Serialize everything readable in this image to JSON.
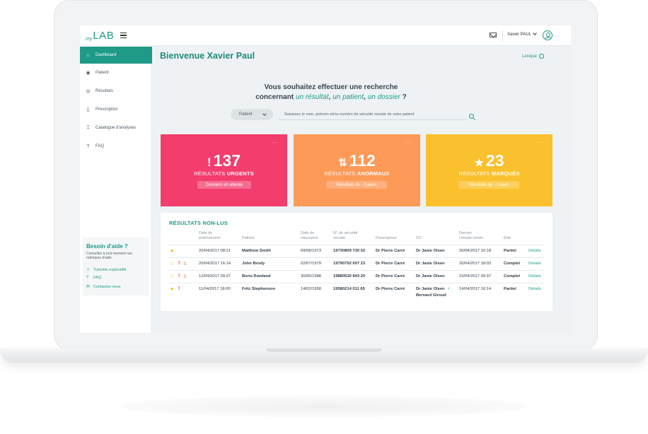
{
  "topbar": {
    "logo_my": "my",
    "logo_lab": "LAB",
    "user_name": "Xavier PAUL"
  },
  "sidebar": {
    "items": [
      {
        "label": "Dashboard",
        "icon": "dashboard-icon"
      },
      {
        "label": "Patient",
        "icon": "patient-icon"
      },
      {
        "label": "Résultats",
        "icon": "eye-icon"
      },
      {
        "label": "Prescription",
        "icon": "prescription-icon"
      },
      {
        "label": "Catalogue d'analyses",
        "icon": "test-tube-icon"
      },
      {
        "label": "FAQ",
        "icon": "question-icon"
      }
    ],
    "help": {
      "title": "Besoin d'aide ?",
      "subtitle": "Consultez à tout moment nos rubriques d'aide.",
      "links": [
        {
          "label": "Tutoriels explicatifs",
          "icon": "magic-wand-icon"
        },
        {
          "label": "FAQ",
          "icon": "question-icon"
        },
        {
          "label": "Contactez-nous",
          "icon": "contact-icon"
        }
      ]
    }
  },
  "main": {
    "welcome": "Bienvenue Xavier Paul",
    "lexique": "Lexique",
    "question_line1": "Vous souhaitez effectuer une recherche",
    "question_line2_prefix": "concernant ",
    "question_em1": "un résultat",
    "question_sep1": ", ",
    "question_em2": "un patient",
    "question_sep2": ", ",
    "question_em3": "un dossier",
    "question_suffix": " ?",
    "search_type": "Patient",
    "search_placeholder": "Saisissez le nom, prénom et/ou numéro de sécurité sociale de votre patient"
  },
  "cards": [
    {
      "icon": "!",
      "count": "137",
      "label_prefix": "RÉSULTATS ",
      "label_bold": "URGENTS",
      "pill": "Dossiers en attente",
      "color": "#f23d6d",
      "pill_bg": "#f56d90"
    },
    {
      "icon": "⇅",
      "count": "112",
      "label_prefix": "RÉSULTATS ",
      "label_bold": "ANORMAUX",
      "pill": "Résultats de - 3 jours",
      "color": "#fd9a58",
      "pill_bg": "#fdb07d"
    },
    {
      "icon": "★",
      "count": "23",
      "label_prefix": "RÉSULTATS ",
      "label_bold": "MARQUÉS",
      "pill": "Résultats de - 3 jours",
      "color": "#fbc02d",
      "pill_bg": "#fcce5a"
    }
  ],
  "table": {
    "title": "RÉSULTATS NON-LUS",
    "headers": {
      "date_prelev": [
        "Date de",
        "prélèvement"
      ],
      "patient": "Patient",
      "naissance": [
        "Date de",
        "naissance"
      ],
      "secu": [
        "N° de sécurité",
        "sociale"
      ],
      "prescripteur": "Prescripteur",
      "cc": "CC",
      "dernier": [
        "Dernier",
        "compte-rendu"
      ],
      "etat": "Etat"
    },
    "rows": [
      {
        "date": "20/04/2017 08:21",
        "patient": "Matthew Smith",
        "naissance": "09/08/1973",
        "secu": "19730809 730 02",
        "prescripteur": "Dr Pierre Carré",
        "cc": "Dr Janie Olsen",
        "cc2": "",
        "dernier": "20/04/2017 16:18",
        "etat": "Partiel",
        "action": "Détails",
        "star": "filled",
        "urgent": false,
        "abnormal": false
      },
      {
        "date": "20/04/2017 16:14",
        "patient": "John Brody",
        "naissance": "02/07/1979",
        "secu": "19790702 007 23",
        "prescripteur": "Dr Pierre Carré",
        "cc": "Dr Janie Olsen",
        "cc2": "",
        "dernier": "20/04/2017 18:03",
        "etat": "Complet",
        "action": "Détails",
        "star": "outline",
        "urgent": true,
        "abnormal": true
      },
      {
        "date": "12/04/2017 09:37",
        "patient": "Boris Rowland",
        "naissance": "30/05/1988",
        "secu": "19880530 843 20",
        "prescripteur": "Dr Pierre Carré",
        "cc": "Dr Janie Olsen",
        "cc2": "",
        "dernier": "16/04/2017 09:37",
        "etat": "Complet",
        "action": "Détails",
        "star": "outline",
        "urgent": true,
        "abnormal": true
      },
      {
        "date": "11/04/2017 18:00",
        "patient": "Fritz Stephenson",
        "naissance": "14/02/1958",
        "secu": "19580214 011 65",
        "prescripteur": "Dr Pierre Carré",
        "cc": "Dr Janie Olsen",
        "cc2": "Bernard Giroud",
        "dernier": "14/04/2017 16:14",
        "etat": "Partiel",
        "action": "Détails",
        "star": "filled",
        "urgent": true,
        "abnormal": false
      }
    ]
  }
}
